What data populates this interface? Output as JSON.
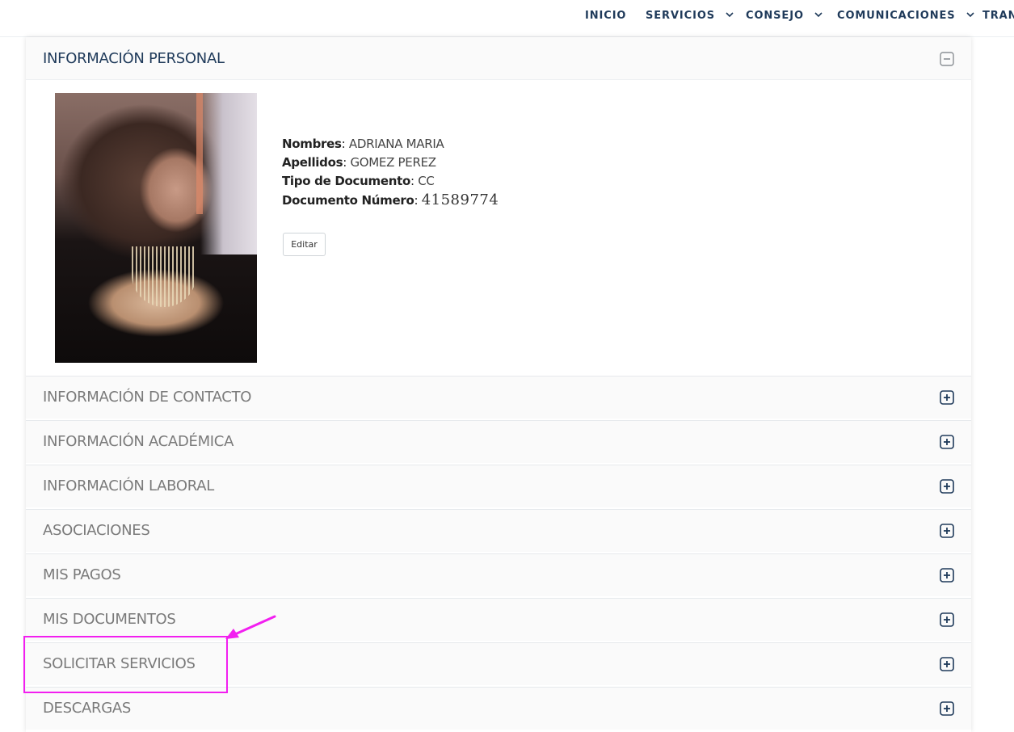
{
  "nav": {
    "items": [
      {
        "label": "INICIO",
        "dropdown": false
      },
      {
        "label": "SERVICIOS",
        "dropdown": true
      },
      {
        "label": "CONSEJO",
        "dropdown": true
      },
      {
        "label": "COMUNICACIONES",
        "dropdown": true
      },
      {
        "label": "TRAN",
        "dropdown": false
      }
    ]
  },
  "accordion": {
    "open_panel": {
      "title": "INFORMACIÓN PERSONAL",
      "toggle_icon": "minus-square-icon",
      "fields": [
        {
          "label": "Nombres",
          "value": "ADRIANA MARIA"
        },
        {
          "label": "Apellidos",
          "value": "GOMEZ PEREZ"
        },
        {
          "label": "Tipo de Documento",
          "value": "CC"
        },
        {
          "label": "Documento Número",
          "value": "41589774"
        }
      ],
      "edit_label": "Editar"
    },
    "panels": [
      {
        "title": "INFORMACIÓN DE CONTACTO"
      },
      {
        "title": "INFORMACIÓN ACADÉMICA"
      },
      {
        "title": "INFORMACIÓN LABORAL"
      },
      {
        "title": "ASOCIACIONES"
      },
      {
        "title": "MIS PAGOS"
      },
      {
        "title": "MIS DOCUMENTOS"
      },
      {
        "title": "SOLICITAR SERVICIOS"
      },
      {
        "title": "DESCARGAS"
      }
    ],
    "collapsed_toggle_icon": "plus-square-icon"
  },
  "colors": {
    "nav_text": "#1f3a5a",
    "open_title": "#1f3a5a",
    "panel_text": "#7a7a7a",
    "toggle_icon": "#1f3a5a",
    "annotation": "#f21ff0"
  }
}
